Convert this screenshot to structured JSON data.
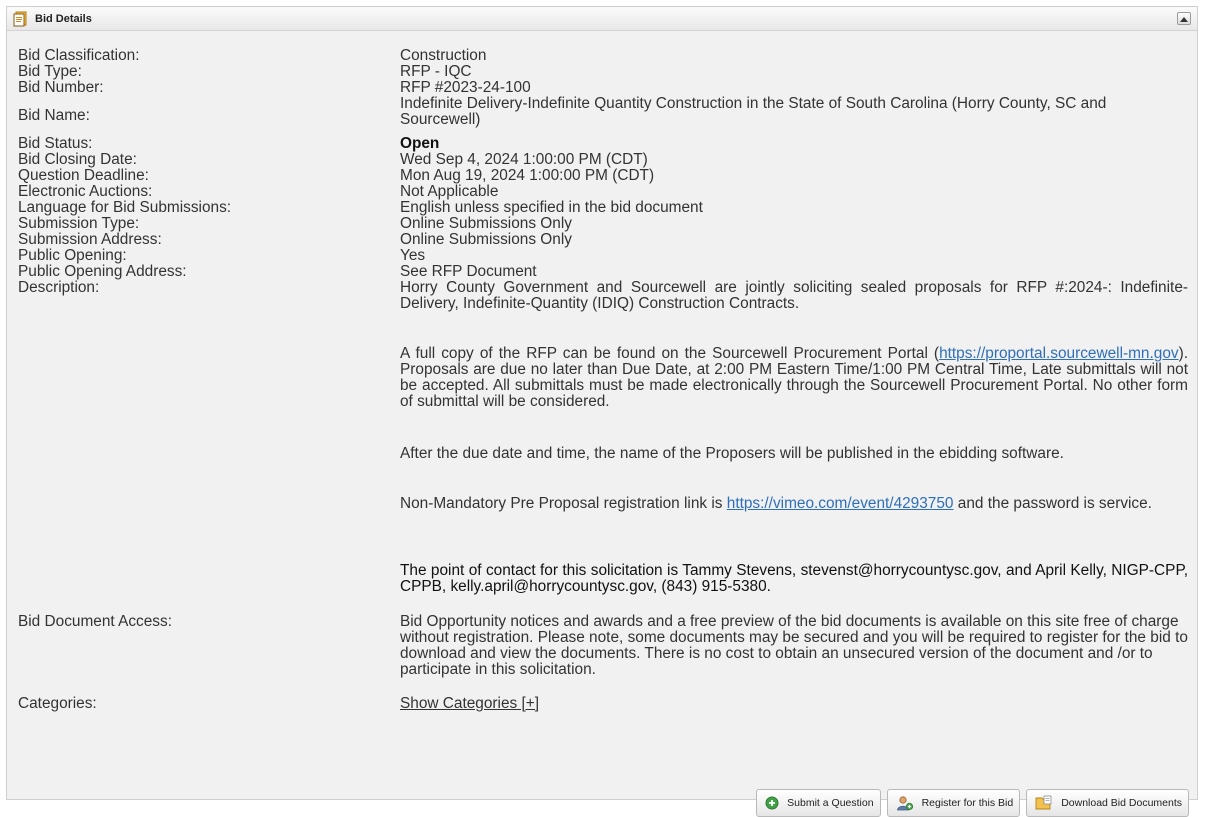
{
  "panel": {
    "title": "Bid Details"
  },
  "fields": {
    "classification": {
      "label": "Bid Classification:",
      "value": "Construction"
    },
    "type": {
      "label": "Bid Type:",
      "value": "RFP - IQC"
    },
    "number": {
      "label": "Bid Number:",
      "value": "RFP #2023-24-100"
    },
    "name": {
      "label": "Bid Name:",
      "value": "Indefinite Delivery-Indefinite Quantity Construction in the State of South Carolina (Horry County, SC and Sourcewell)"
    },
    "status": {
      "label": "Bid Status:",
      "value": "Open"
    },
    "closing": {
      "label": "Bid Closing Date:",
      "value": "Wed Sep 4, 2024 1:00:00 PM (CDT)"
    },
    "question": {
      "label": "Question Deadline:",
      "value": "Mon Aug 19, 2024 1:00:00 PM (CDT)"
    },
    "auctions": {
      "label": "Electronic Auctions:",
      "value": "Not Applicable"
    },
    "language": {
      "label": "Language for Bid Submissions:",
      "value": "English unless specified in the bid document"
    },
    "submission_type": {
      "label": "Submission Type:",
      "value": "Online Submissions Only"
    },
    "submission_address": {
      "label": "Submission Address:",
      "value": "Online Submissions Only"
    },
    "public_opening": {
      "label": "Public Opening:",
      "value": "Yes"
    },
    "public_opening_address": {
      "label": "Public Opening Address:",
      "value": "See RFP Document"
    },
    "description": {
      "label": "Description:",
      "p1": "Horry County Government and Sourcewell are jointly soliciting sealed proposals for RFP #:2024-: Indefinite-Delivery, Indefinite-Quantity (IDIQ) Construction Contracts.",
      "p2_before": "A full copy of the RFP can be found on the Sourcewell Procurement Portal (",
      "p2_link": "https://proportal.sourcewell-mn.gov",
      "p2_after": "). Proposals are due no later than Due Date, at 2:00 PM Eastern Time/1:00 PM Central Time, Late submittals will not be accepted. All submittals must be made electronically through the Sourcewell Procurement Portal. No other form of submittal will be considered.",
      "p3": "After the due date and time, the name of the Proposers will be published in the ebidding software.",
      "p4_before": "Non-Mandatory Pre Proposal registration link is ",
      "p4_link": "https://vimeo.com/event/4293750",
      "p4_after": " and the password is service.",
      "p5": "The point of contact for this solicitation is Tammy Stevens, stevenst@horrycountysc.gov, and April Kelly, NIGP-CPP, CPPB, kelly.april@horrycountysc.gov, (843) 915-5380."
    },
    "document_access": {
      "label": "Bid Document Access:",
      "value": "Bid Opportunity notices and awards and a free preview of the bid documents is available on this site free of charge without registration. Please note, some documents may be secured and you will be required to register for the bid to download and view the documents. There is no cost to obtain an unsecured version of the document and /or to participate in this solicitation."
    },
    "categories": {
      "label": "Categories:",
      "link": "Show Categories [+]"
    }
  },
  "buttons": {
    "submit_question": "Submit a Question",
    "register": "Register for this Bid",
    "download": "Download Bid Documents"
  }
}
